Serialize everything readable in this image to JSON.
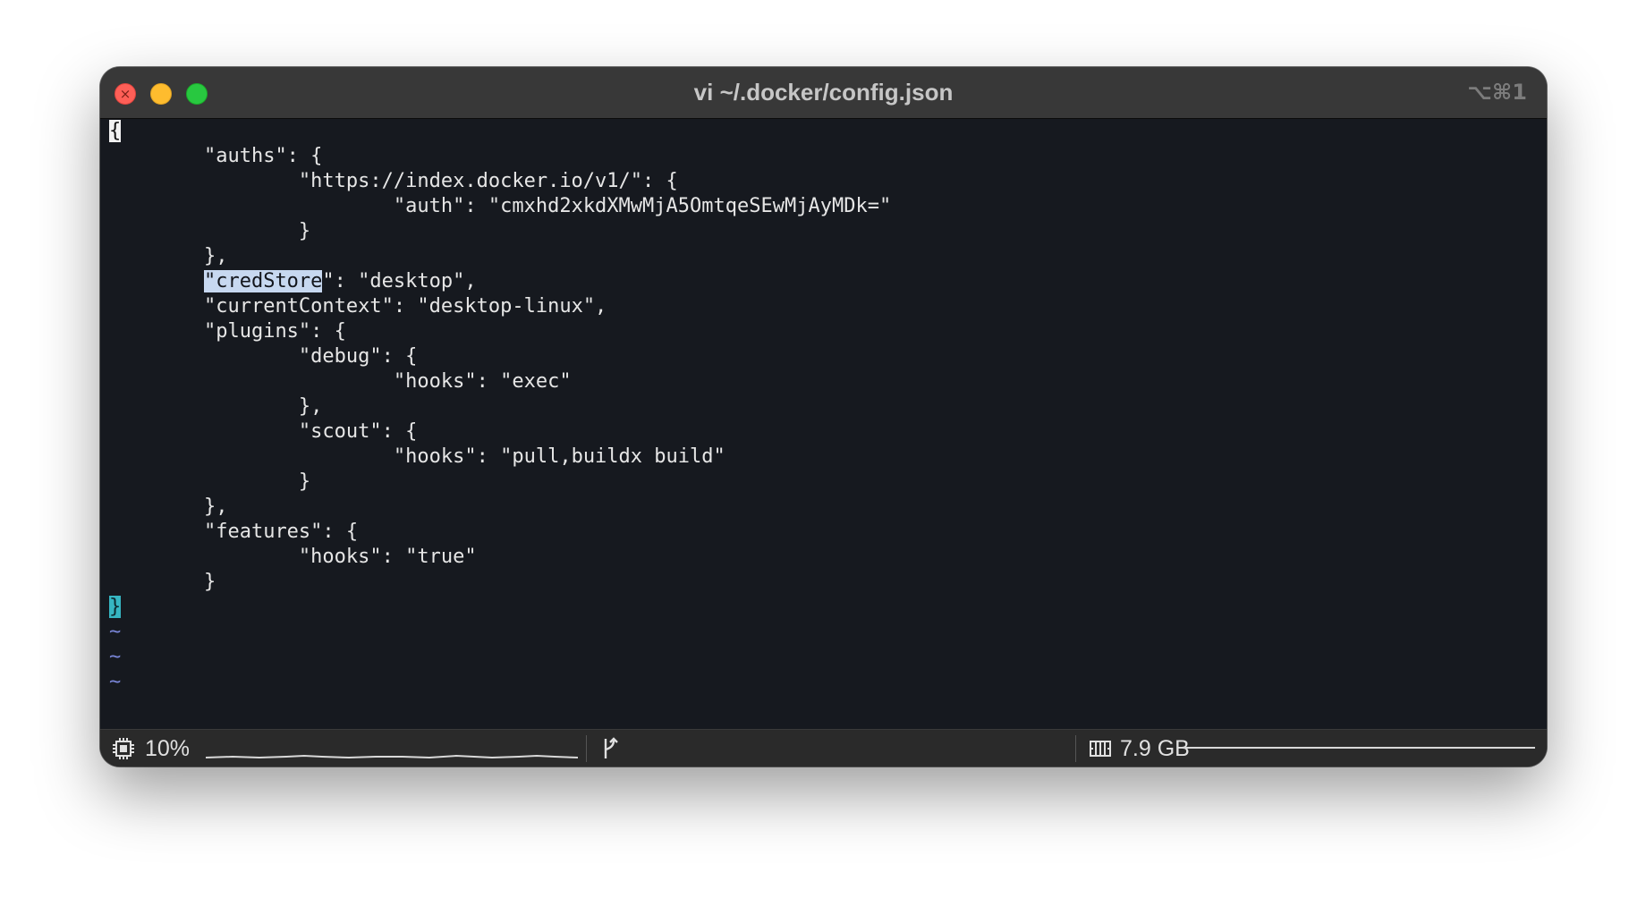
{
  "window": {
    "title": "vi ~/.docker/config.json",
    "shortcut": "⌥⌘1",
    "close_glyph": "×"
  },
  "editor": {
    "lines": [
      {
        "indent": "",
        "text": "{"
      },
      {
        "indent": "        ",
        "text": "\"auths\": {"
      },
      {
        "indent": "                ",
        "text": "\"https://index.docker.io/v1/\": {"
      },
      {
        "indent": "                        ",
        "text": "\"auth\": \"cmxhd2xkdXMwMjA5OmtqeSEwMjAyMDk=\""
      },
      {
        "indent": "                ",
        "text": "}"
      },
      {
        "indent": "        ",
        "text": "},"
      },
      {
        "indent": "        ",
        "highlight": "\"credStore",
        "text": "\": \"desktop\","
      },
      {
        "indent": "        ",
        "text": "\"currentContext\": \"desktop-linux\","
      },
      {
        "indent": "        ",
        "text": "\"plugins\": {"
      },
      {
        "indent": "                ",
        "text": "\"debug\": {"
      },
      {
        "indent": "                        ",
        "text": "\"hooks\": \"exec\""
      },
      {
        "indent": "                ",
        "text": "},"
      },
      {
        "indent": "                ",
        "text": "\"scout\": {"
      },
      {
        "indent": "                        ",
        "text": "\"hooks\": \"pull,buildx build\""
      },
      {
        "indent": "                ",
        "text": "}"
      },
      {
        "indent": "        ",
        "text": "},"
      },
      {
        "indent": "        ",
        "text": "\"features\": {"
      },
      {
        "indent": "                ",
        "text": "\"hooks\": \"true\""
      },
      {
        "indent": "        ",
        "text": "}"
      },
      {
        "indent": "",
        "text": "}"
      }
    ],
    "tildes": [
      "~",
      "~",
      "~"
    ]
  },
  "status": {
    "cpu_percent": "10%",
    "cpu_icon": "cpu-chip-icon",
    "branch_icon": "git-branch-icon",
    "memory": "7.9 GB",
    "memory_icon": "memory-icon",
    "memory_used_fraction": 1.0
  },
  "colors": {
    "background": "#16191f",
    "text": "#e6e6e6",
    "search_highlight": "#c7d8f0",
    "match_bracket": "#36b6c2",
    "tilde": "#7a86d8",
    "titlebar": "#383838",
    "statusbar": "#2a2a2a"
  }
}
